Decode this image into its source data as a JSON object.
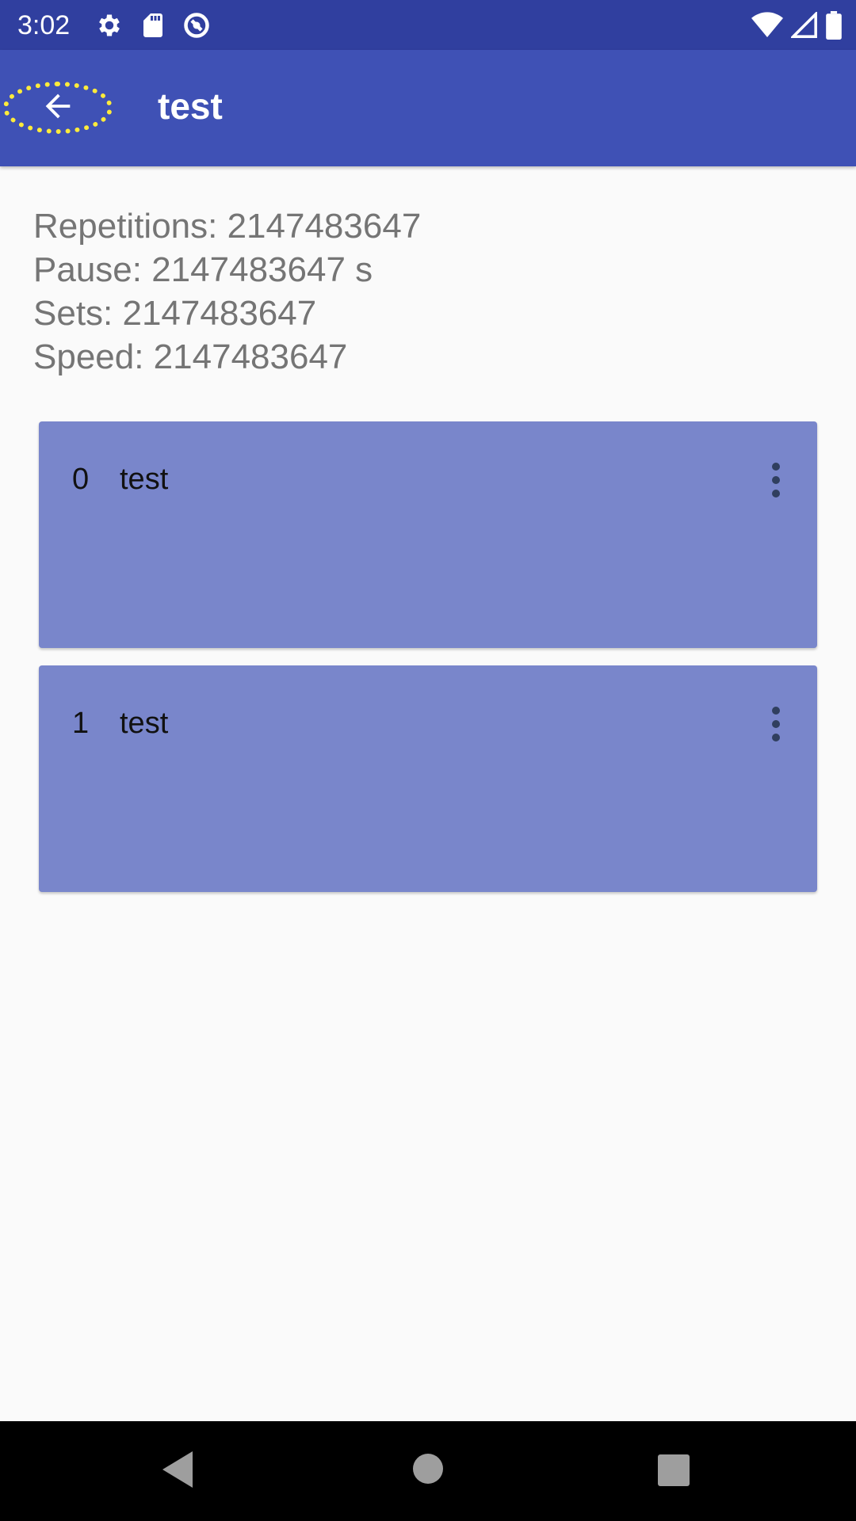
{
  "status_bar": {
    "time": "3:02",
    "left_icons": [
      "gear-icon",
      "sd-card-icon",
      "do-not-disturb-icon"
    ],
    "right_icons": [
      "wifi-icon",
      "signal-icon",
      "battery-icon"
    ]
  },
  "app_bar": {
    "title": "test",
    "back_icon": "arrow-back-icon"
  },
  "info": {
    "repetitions": "Repetitions: 2147483647",
    "pause": "Pause: 2147483647 s",
    "sets": "Sets: 2147483647",
    "speed": "Speed: 2147483647"
  },
  "cards": [
    {
      "index": "0",
      "name": "test"
    },
    {
      "index": "1",
      "name": "test"
    }
  ],
  "nav_bar": {
    "icons": [
      "back-triangle-icon",
      "home-circle-icon",
      "recents-square-icon"
    ]
  },
  "colors": {
    "status_bar": "#303F9F",
    "app_bar": "#3F51B5",
    "card": "#7986CB",
    "background": "#FAFAFA"
  }
}
